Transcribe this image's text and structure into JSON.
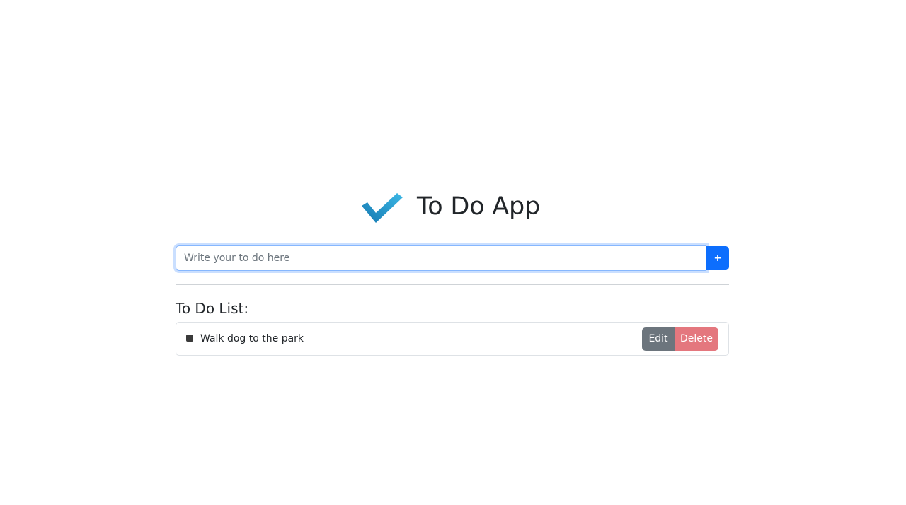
{
  "app": {
    "title": "To Do App",
    "logo_icon": "checkmark-icon",
    "accent_color": "#0d6efd"
  },
  "add_form": {
    "input_value": "",
    "input_placeholder": "Write your to do here",
    "add_label": "+"
  },
  "list": {
    "heading": "To Do List:",
    "items": [
      {
        "text": "Walk dog to the park",
        "checked": false,
        "edit_label": "Edit",
        "delete_label": "Delete"
      }
    ]
  }
}
